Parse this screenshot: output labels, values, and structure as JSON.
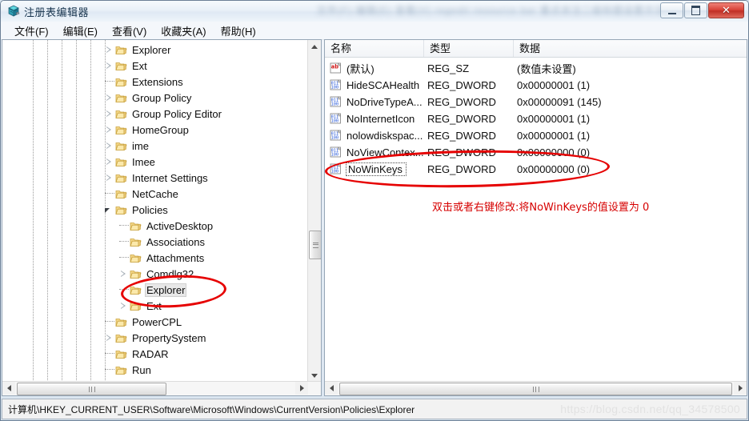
{
  "window": {
    "title": "注册表编辑器",
    "icon": "registry-cube-icon",
    "blurred_background_text": "文件(F) 编辑(E) 查看(V) regedit resource bar 重点关注二级标题设置方法",
    "buttons": {
      "minimize": "minimize-button",
      "maximize": "maximize-button",
      "close": "✕"
    }
  },
  "menubar": {
    "items": [
      {
        "label": "文件(F)"
      },
      {
        "label": "编辑(E)"
      },
      {
        "label": "查看(V)"
      },
      {
        "label": "收藏夹(A)"
      },
      {
        "label": "帮助(H)"
      }
    ]
  },
  "tree": {
    "nodes": [
      {
        "label": "Explorer",
        "indent": 0,
        "arrow": "collapsed",
        "selected": false
      },
      {
        "label": "Ext",
        "indent": 0,
        "arrow": "collapsed",
        "selected": false
      },
      {
        "label": "Extensions",
        "indent": 0,
        "arrow": "none",
        "selected": false
      },
      {
        "label": "Group Policy",
        "indent": 0,
        "arrow": "collapsed",
        "selected": false
      },
      {
        "label": "Group Policy Editor",
        "indent": 0,
        "arrow": "collapsed",
        "selected": false
      },
      {
        "label": "HomeGroup",
        "indent": 0,
        "arrow": "collapsed",
        "selected": false
      },
      {
        "label": "ime",
        "indent": 0,
        "arrow": "collapsed",
        "selected": false
      },
      {
        "label": "Imee",
        "indent": 0,
        "arrow": "collapsed",
        "selected": false
      },
      {
        "label": "Internet Settings",
        "indent": 0,
        "arrow": "collapsed",
        "selected": false
      },
      {
        "label": "NetCache",
        "indent": 0,
        "arrow": "none",
        "selected": false
      },
      {
        "label": "Policies",
        "indent": 0,
        "arrow": "expanded",
        "selected": false
      },
      {
        "label": "ActiveDesktop",
        "indent": 1,
        "arrow": "none",
        "selected": false
      },
      {
        "label": "Associations",
        "indent": 1,
        "arrow": "none",
        "selected": false
      },
      {
        "label": "Attachments",
        "indent": 1,
        "arrow": "none",
        "selected": false
      },
      {
        "label": "Comdlg32",
        "indent": 1,
        "arrow": "collapsed",
        "selected": false
      },
      {
        "label": "Explorer",
        "indent": 1,
        "arrow": "none",
        "selected": true
      },
      {
        "label": "Ext",
        "indent": 1,
        "arrow": "collapsed",
        "selected": false
      },
      {
        "label": "PowerCPL",
        "indent": 0,
        "arrow": "none",
        "selected": false
      },
      {
        "label": "PropertySystem",
        "indent": 0,
        "arrow": "collapsed",
        "selected": false
      },
      {
        "label": "RADAR",
        "indent": 0,
        "arrow": "none",
        "selected": false
      },
      {
        "label": "Run",
        "indent": 0,
        "arrow": "none",
        "selected": false
      }
    ]
  },
  "list": {
    "columns": [
      {
        "label": "名称"
      },
      {
        "label": "类型"
      },
      {
        "label": "数据"
      }
    ],
    "rows": [
      {
        "name": "(默认)",
        "type": "REG_SZ",
        "data": "(数值未设置)",
        "icon": "string-value-icon",
        "focused": false
      },
      {
        "name": "HideSCAHealth",
        "type": "REG_DWORD",
        "data": "0x00000001 (1)",
        "icon": "dword-value-icon",
        "focused": false
      },
      {
        "name": "NoDriveTypeA...",
        "type": "REG_DWORD",
        "data": "0x00000091 (145)",
        "icon": "dword-value-icon",
        "focused": false
      },
      {
        "name": "NoInternetIcon",
        "type": "REG_DWORD",
        "data": "0x00000001 (1)",
        "icon": "dword-value-icon",
        "focused": false
      },
      {
        "name": "nolowdiskspac...",
        "type": "REG_DWORD",
        "data": "0x00000001 (1)",
        "icon": "dword-value-icon",
        "focused": false
      },
      {
        "name": "NoViewContex...",
        "type": "REG_DWORD",
        "data": "0x00000000 (0)",
        "icon": "dword-value-icon",
        "focused": false
      },
      {
        "name": "NoWinKeys",
        "type": "REG_DWORD",
        "data": "0x00000000 (0)",
        "icon": "dword-value-icon",
        "focused": true
      }
    ]
  },
  "annotation": {
    "text": "双击或者右键修改:将NoWinKeys的值设置为 0",
    "color": "#d60000",
    "ellipses": [
      {
        "target": "tree-explorer-node"
      },
      {
        "target": "list-row-nowinkeys"
      }
    ]
  },
  "statusbar": {
    "path": "计算机\\HKEY_CURRENT_USER\\Software\\Microsoft\\Windows\\CurrentVersion\\Policies\\Explorer",
    "watermark": "https://blog.csdn.net/qq_34578500"
  }
}
